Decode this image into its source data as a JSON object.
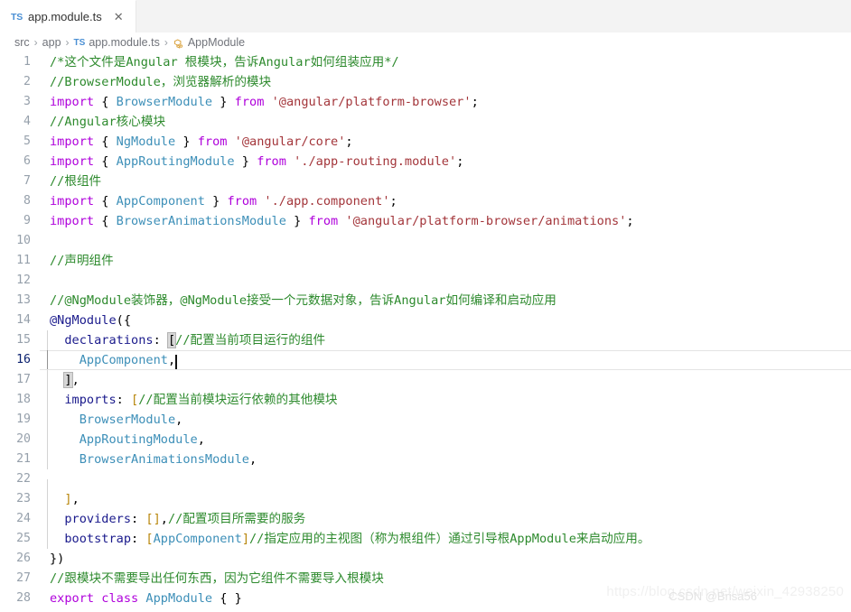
{
  "tab": {
    "file_type_badge": "TS",
    "label": "app.module.ts",
    "close_glyph": "✕"
  },
  "breadcrumb": {
    "src": "src",
    "app": "app",
    "file_badge": "TS",
    "file": "app.module.ts",
    "symbol": "AppModule",
    "separator": "›"
  },
  "editor": {
    "caret_line": 16,
    "lines": [
      {
        "n": "1",
        "tokens": [
          {
            "t": "/*这个文件是Angular 根模块，告诉Angular如何组装应用*/",
            "c": "cm"
          }
        ]
      },
      {
        "n": "2",
        "tokens": [
          {
            "t": "//BrowserModule，浏览器解析的模块",
            "c": "cm"
          }
        ]
      },
      {
        "n": "3",
        "tokens": [
          {
            "t": "import",
            "c": "kw"
          },
          {
            "t": " { ",
            "c": "pn"
          },
          {
            "t": "BrowserModule",
            "c": "ty"
          },
          {
            "t": " } ",
            "c": "pn"
          },
          {
            "t": "from",
            "c": "kw"
          },
          {
            "t": " ",
            "c": "pn"
          },
          {
            "t": "'@angular/platform-browser'",
            "c": "st"
          },
          {
            "t": ";",
            "c": "pn"
          }
        ]
      },
      {
        "n": "4",
        "tokens": [
          {
            "t": "//Angular核心模块",
            "c": "cm"
          }
        ]
      },
      {
        "n": "5",
        "tokens": [
          {
            "t": "import",
            "c": "kw"
          },
          {
            "t": " { ",
            "c": "pn"
          },
          {
            "t": "NgModule",
            "c": "ty"
          },
          {
            "t": " } ",
            "c": "pn"
          },
          {
            "t": "from",
            "c": "kw"
          },
          {
            "t": " ",
            "c": "pn"
          },
          {
            "t": "'@angular/core'",
            "c": "st"
          },
          {
            "t": ";",
            "c": "pn"
          }
        ]
      },
      {
        "n": "6",
        "tokens": [
          {
            "t": "import",
            "c": "kw"
          },
          {
            "t": " { ",
            "c": "pn"
          },
          {
            "t": "AppRoutingModule",
            "c": "ty"
          },
          {
            "t": " } ",
            "c": "pn"
          },
          {
            "t": "from",
            "c": "kw"
          },
          {
            "t": " ",
            "c": "pn"
          },
          {
            "t": "'./app-routing.module'",
            "c": "st"
          },
          {
            "t": ";",
            "c": "pn"
          }
        ]
      },
      {
        "n": "7",
        "tokens": [
          {
            "t": "//根组件",
            "c": "cm"
          }
        ]
      },
      {
        "n": "8",
        "tokens": [
          {
            "t": "import",
            "c": "kw"
          },
          {
            "t": " { ",
            "c": "pn"
          },
          {
            "t": "AppComponent",
            "c": "ty"
          },
          {
            "t": " } ",
            "c": "pn"
          },
          {
            "t": "from",
            "c": "kw"
          },
          {
            "t": " ",
            "c": "pn"
          },
          {
            "t": "'./app.component'",
            "c": "st"
          },
          {
            "t": ";",
            "c": "pn"
          }
        ]
      },
      {
        "n": "9",
        "tokens": [
          {
            "t": "import",
            "c": "kw"
          },
          {
            "t": " { ",
            "c": "pn"
          },
          {
            "t": "BrowserAnimationsModule",
            "c": "ty"
          },
          {
            "t": " } ",
            "c": "pn"
          },
          {
            "t": "from",
            "c": "kw"
          },
          {
            "t": " ",
            "c": "pn"
          },
          {
            "t": "'@angular/platform-browser/animations'",
            "c": "st"
          },
          {
            "t": ";",
            "c": "pn"
          }
        ]
      },
      {
        "n": "10",
        "tokens": []
      },
      {
        "n": "11",
        "tokens": [
          {
            "t": "//声明组件",
            "c": "cm"
          }
        ]
      },
      {
        "n": "12",
        "tokens": []
      },
      {
        "n": "13",
        "tokens": [
          {
            "t": "//@NgModule装饰器，@NgModule接受一个元数据对象，告诉Angular如何编译和启动应用",
            "c": "cm"
          }
        ]
      },
      {
        "n": "14",
        "tokens": [
          {
            "t": "@NgModule",
            "c": "dec"
          },
          {
            "t": "({",
            "c": "pn"
          }
        ]
      },
      {
        "n": "15",
        "tokens": [
          {
            "t": "  declarations",
            "c": "pl"
          },
          {
            "t": ": ",
            "c": "pn"
          },
          {
            "t": "[",
            "c": "pn brkmatch"
          },
          {
            "t": "//配置当前项目运行的组件",
            "c": "cm"
          }
        ]
      },
      {
        "n": "16",
        "active": true,
        "tokens": [
          {
            "t": "    ",
            "c": "pn"
          },
          {
            "t": "AppComponent",
            "c": "ty"
          },
          {
            "t": ",",
            "c": "pn"
          }
        ],
        "caret": true
      },
      {
        "n": "17",
        "tokens": [
          {
            "t": "  ",
            "c": "pn"
          },
          {
            "t": "]",
            "c": "pn brkmatch"
          },
          {
            "t": ",",
            "c": "pn"
          }
        ]
      },
      {
        "n": "18",
        "tokens": [
          {
            "t": "  imports",
            "c": "pl"
          },
          {
            "t": ": ",
            "c": "pn"
          },
          {
            "t": "[",
            "c": "br1"
          },
          {
            "t": "//配置当前模块运行依赖的其他模块",
            "c": "cm"
          }
        ]
      },
      {
        "n": "19",
        "tokens": [
          {
            "t": "    ",
            "c": "pn"
          },
          {
            "t": "BrowserModule",
            "c": "ty"
          },
          {
            "t": ",",
            "c": "pn"
          }
        ]
      },
      {
        "n": "20",
        "tokens": [
          {
            "t": "    ",
            "c": "pn"
          },
          {
            "t": "AppRoutingModule",
            "c": "ty"
          },
          {
            "t": ",",
            "c": "pn"
          }
        ]
      },
      {
        "n": "21",
        "tokens": [
          {
            "t": "    ",
            "c": "pn"
          },
          {
            "t": "BrowserAnimationsModule",
            "c": "ty"
          },
          {
            "t": ",",
            "c": "pn"
          }
        ]
      },
      {
        "n": "22",
        "tokens": []
      },
      {
        "n": "23",
        "tokens": [
          {
            "t": "  ",
            "c": "pn"
          },
          {
            "t": "]",
            "c": "br1"
          },
          {
            "t": ",",
            "c": "pn"
          }
        ]
      },
      {
        "n": "24",
        "tokens": [
          {
            "t": "  providers",
            "c": "pl"
          },
          {
            "t": ": ",
            "c": "pn"
          },
          {
            "t": "[]",
            "c": "br1"
          },
          {
            "t": ",",
            "c": "pn"
          },
          {
            "t": "//配置项目所需要的服务",
            "c": "cm"
          }
        ]
      },
      {
        "n": "25",
        "tokens": [
          {
            "t": "  bootstrap",
            "c": "pl"
          },
          {
            "t": ": ",
            "c": "pn"
          },
          {
            "t": "[",
            "c": "br1"
          },
          {
            "t": "AppComponent",
            "c": "ty"
          },
          {
            "t": "]",
            "c": "br1"
          },
          {
            "t": "//指定应用的主视图（称为根组件）通过引导根AppModule来启动应用。",
            "c": "cm"
          }
        ]
      },
      {
        "n": "26",
        "tokens": [
          {
            "t": "})",
            "c": "pn"
          }
        ]
      },
      {
        "n": "27",
        "tokens": [
          {
            "t": "//跟模块不需要导出任何东西，因为它组件不需要导入根模块",
            "c": "cm"
          }
        ]
      },
      {
        "n": "28",
        "tokens": [
          {
            "t": "export",
            "c": "kw"
          },
          {
            "t": " ",
            "c": "pn"
          },
          {
            "t": "class",
            "c": "kw"
          },
          {
            "t": " ",
            "c": "pn"
          },
          {
            "t": "AppModule",
            "c": "ty"
          },
          {
            "t": " { }",
            "c": "pn"
          }
        ]
      }
    ],
    "indent_guides": {
      "lines_with_guide": [
        "15",
        "16",
        "17",
        "18",
        "19",
        "20",
        "21",
        "22",
        "23",
        "24",
        "25"
      ],
      "active_guide_lines": [
        "16"
      ]
    }
  },
  "watermarks": {
    "url": "https://blog.csdn.net/weixin_42938250",
    "tag": "CSDN @Brisa56"
  },
  "colors": {
    "comment": "#2d8a2d",
    "keyword": "#af00db",
    "type": "#3d8fb8",
    "string": "#a3353a",
    "plain": "#1a1a8c",
    "bracket_orange": "#b8860b",
    "line_number": "#96a0ab",
    "tab_bar_bg": "#f3f3f3",
    "editor_bg": "#ffffff"
  }
}
